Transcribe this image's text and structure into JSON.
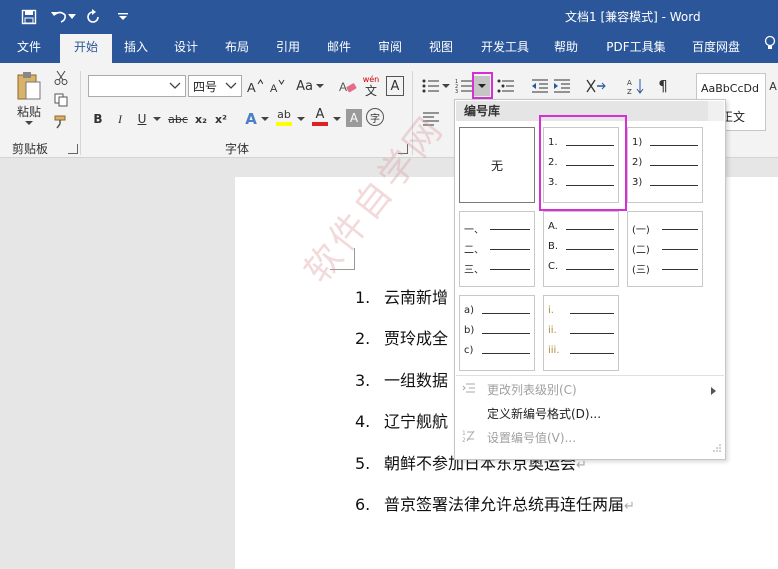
{
  "window": {
    "title": "文档1 [兼容模式] - Word"
  },
  "tabs": [
    "文件",
    "开始",
    "插入",
    "设计",
    "布局",
    "引用",
    "邮件",
    "审阅",
    "视图",
    "开发工具",
    "帮助",
    "PDF工具集",
    "百度网盘"
  ],
  "clipboard": {
    "paste_label": "粘贴",
    "group_label": "剪贴板"
  },
  "font": {
    "name_value": "",
    "size_value": "四号",
    "change_case": "Aa",
    "phonetic_top": "wén",
    "phonetic_bottom": "文",
    "char_border": "A",
    "bold": "B",
    "italic": "I",
    "underline": "U",
    "strike": "abc",
    "sub": "x₂",
    "sup": "x²",
    "text_effect": "A",
    "highlight": "ab",
    "font_color": "A",
    "char_shade": "A",
    "enclose": "字",
    "group_label": "字体"
  },
  "styles": {
    "preview": "AaBbCcDd",
    "label": "正文",
    "partial": "A"
  },
  "document": {
    "items": [
      {
        "num": "1.",
        "text": "云南新增"
      },
      {
        "num": "2.",
        "text": "贾玲成全"
      },
      {
        "num": "3.",
        "text": "一组数据"
      },
      {
        "num": "4.",
        "text": "辽宁舰航"
      },
      {
        "num": "5.",
        "text": "朝鲜不参加日本东京奥运会"
      },
      {
        "num": "6.",
        "text": "普京签署法律允许总统再连任两届"
      }
    ],
    "para_mark": "↵",
    "watermark": "软件自学网"
  },
  "numbering_dropdown": {
    "header": "编号库",
    "none_label": "无",
    "tiles": [
      [
        "1.",
        "2.",
        "3."
      ],
      [
        "1)",
        "2)",
        "3)"
      ],
      [
        "一、",
        "二、",
        "三、"
      ],
      [
        "A.",
        "B.",
        "C."
      ],
      [
        "(一)",
        "(二)",
        "(三)"
      ],
      [
        "a)",
        "b)",
        "c)"
      ],
      [
        "i.",
        "ii.",
        "iii."
      ]
    ],
    "menu": [
      {
        "label": "更改列表级别(C)",
        "disabled": true
      },
      {
        "label": "定义新编号格式(D)...",
        "disabled": false
      },
      {
        "label": "设置编号值(V)...",
        "disabled": true
      }
    ]
  },
  "colors": {
    "title_bar": "#2b579a",
    "highlight_box": "#d62fd6",
    "font_color_bar": "#e02020",
    "highlight_bar": "#ffff00"
  }
}
